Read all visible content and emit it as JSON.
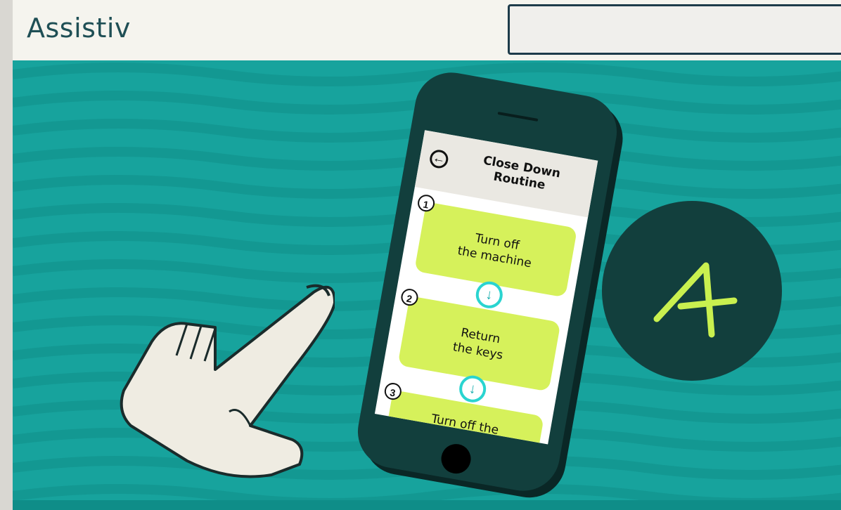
{
  "header": {
    "brand": "Assistiv",
    "search": {
      "value": "",
      "placeholder": ""
    }
  },
  "phone_app": {
    "title_line1": "Close Down",
    "title_line2": "Routine",
    "steps": [
      {
        "number": "1",
        "line1": "Turn off",
        "line2": "the machine"
      },
      {
        "number": "2",
        "line1": "Return",
        "line2": "the keys"
      },
      {
        "number": "3",
        "line1": "Turn off the",
        "line2": ""
      }
    ]
  },
  "badge": {
    "letter": "A"
  },
  "colors": {
    "background_teal": "#17a39d",
    "phone_body": "#123f3d",
    "card_lime": "#d6f15b",
    "arrow_cyan": "#2ad4d0",
    "brand_text": "#1f4f55"
  },
  "icons": [
    "back-arrow-icon",
    "down-arrow-icon",
    "pointing-hand",
    "assistiv-badge"
  ]
}
